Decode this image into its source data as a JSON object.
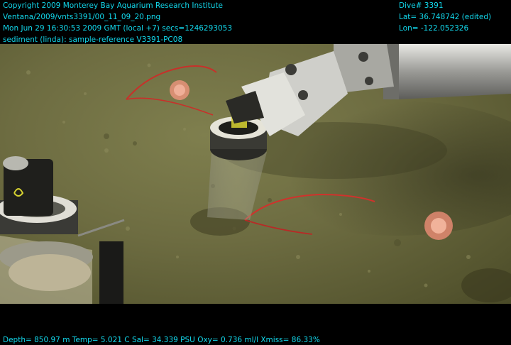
{
  "overlay": {
    "top_left": [
      "Copyright 2009 Monterey Bay Aquarium Research Institute",
      "Ventana/2009/vnts3391/00_11_09_20.png",
      "Mon Jun 29 16:30:53 2009 GMT (local +7)  secs=1246293053",
      "sediment (linda): sample-reference V3391-PC08"
    ],
    "top_right": [
      "Dive# 3391",
      "Lat= 36.748742 (edited)",
      "Lon= -122.052326"
    ],
    "bottom": "Depth= 850.97 m  Temp= 5.021 C  Sal= 34.339 PSU  Oxy= 0.736 ml/l  Xmiss= 86.33%"
  },
  "colors": {
    "overlay_text": "#12d8ec",
    "seafloor": "#6d6c41",
    "sea_pen_red": "#c8302a",
    "anemone": "#e7937a"
  }
}
